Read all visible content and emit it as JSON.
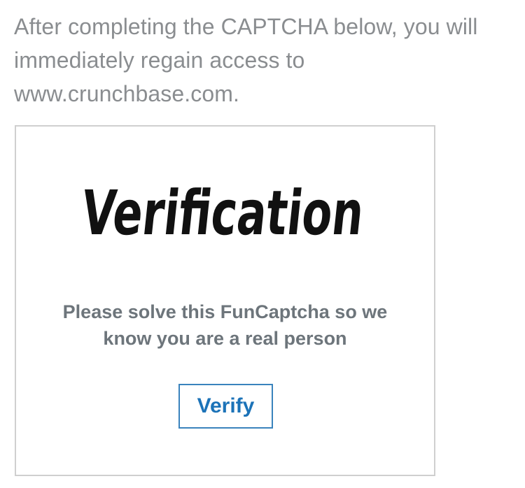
{
  "intro_text": "After completing the CAPTCHA below, you will immediately regain access to www.crunchbase.com.",
  "captcha": {
    "logo_text": "Verification",
    "instruction_line1": "Please solve this FunCaptcha so we",
    "instruction_line2": "know you are a real person",
    "verify_button_label": "Verify"
  },
  "colors": {
    "intro_text": "#8a8d90",
    "instruction_text": "#6d757b",
    "button_text": "#1c73b8",
    "button_border": "#3a83bd",
    "box_border": "#cfcfcf",
    "logo": "#111111"
  }
}
